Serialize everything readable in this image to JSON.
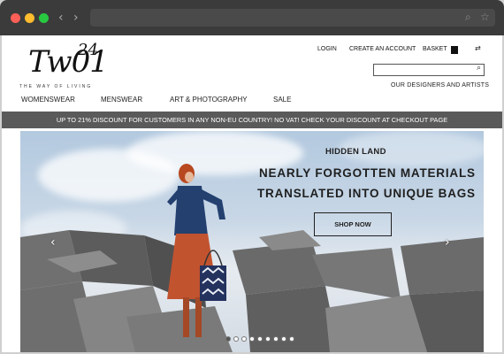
{
  "browser": {
    "back_icon": "‹",
    "forward_icon": "›",
    "search_icon": "⌕",
    "star_icon": "☆"
  },
  "logo": {
    "mark": "Tw01",
    "number": "24",
    "tagline": "THE WAY OF LIVING"
  },
  "header_links": {
    "login": "LOGIN",
    "create_account": "CREATE AN ACCOUNT",
    "basket": "BASKET",
    "language_icon": "⇄"
  },
  "search": {
    "placeholder": "",
    "icon": "⌕"
  },
  "designers_link": "OUR DESIGNERS AND ARTISTS",
  "nav": {
    "womenswear": "WOMENSWEAR",
    "menswear": "MENSWEAR",
    "art": "ART & PHOTOGRAPHY",
    "sale": "SALE"
  },
  "promo": "UP TO 21% DISCOUNT FOR CUSTOMERS IN ANY NON-EU COUNTRY! NO VAT! CHECK YOUR DISCOUNT AT CHECKOUT PAGE",
  "hero": {
    "kicker": "HIDDEN LAND",
    "headline_1": "NEARLY FORGOTTEN MATERIALS",
    "headline_2": "TRANSLATED INTO UNIQUE BAGS",
    "cta": "SHOP NOW",
    "prev_icon": "‹",
    "next_icon": "›",
    "slide_count": 9,
    "active_slide": 1
  },
  "colors": {
    "chrome": "#3b3b3b",
    "promo_bar": "#5a5a5a",
    "skirt": "#c2532f",
    "shirt": "#1f3f7a",
    "rock": "#6f6f6f"
  }
}
